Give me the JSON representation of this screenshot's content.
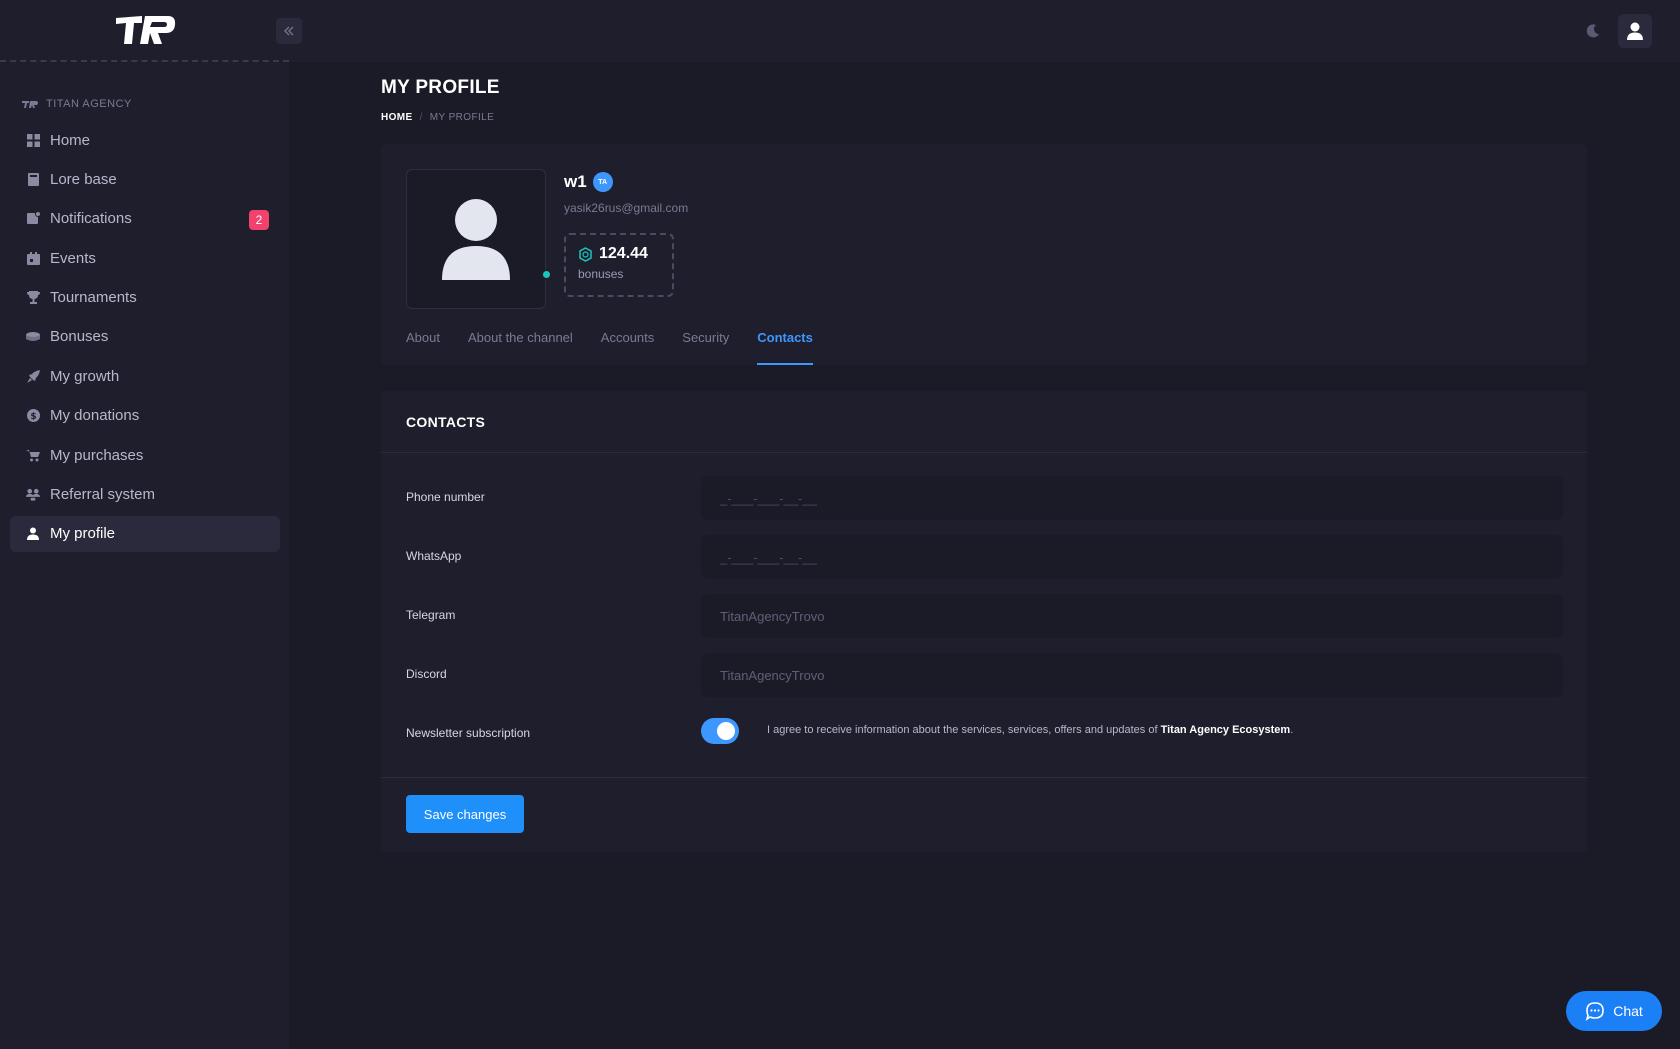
{
  "app": {
    "brand": "TA",
    "section_label": "TITAN AGENCY"
  },
  "sidebar": {
    "items": [
      {
        "label": "Home",
        "icon": "grid-icon"
      },
      {
        "label": "Lore base",
        "icon": "book-icon"
      },
      {
        "label": "Notifications",
        "icon": "bell-icon",
        "badge": "2"
      },
      {
        "label": "Events",
        "icon": "calendar-icon"
      },
      {
        "label": "Tournaments",
        "icon": "trophy-icon"
      },
      {
        "label": "Bonuses",
        "icon": "coins-icon"
      },
      {
        "label": "My growth",
        "icon": "rocket-icon"
      },
      {
        "label": "My donations",
        "icon": "dollar-icon"
      },
      {
        "label": "My purchases",
        "icon": "cart-icon"
      },
      {
        "label": "Referral system",
        "icon": "people-icon"
      },
      {
        "label": "My profile",
        "icon": "user-icon",
        "active": true
      }
    ]
  },
  "header": {
    "title": "MY PROFILE",
    "breadcrumb": {
      "home": "HOME",
      "sep": "/",
      "current": "MY PROFILE"
    }
  },
  "profile": {
    "username": "w1",
    "verified_badge": "TA",
    "email": "yasik26rus@gmail.com",
    "bonus_value": "124.44",
    "bonus_label": "bonuses",
    "online": true
  },
  "tabs": [
    {
      "label": "About"
    },
    {
      "label": "About the channel"
    },
    {
      "label": "Accounts"
    },
    {
      "label": "Security"
    },
    {
      "label": "Contacts",
      "active": true
    }
  ],
  "contacts": {
    "title": "CONTACTS",
    "phone": {
      "label": "Phone number",
      "placeholder": "_-___-___-__-__"
    },
    "whatsapp": {
      "label": "WhatsApp",
      "placeholder": "_-___-___-__-__"
    },
    "telegram": {
      "label": "Telegram",
      "value": "TitanAgencyTrovo"
    },
    "discord": {
      "label": "Discord",
      "value": "TitanAgencyTrovo"
    },
    "newsletter": {
      "label": "Newsletter subscription",
      "enabled": true,
      "text": "I agree to receive information about the services, services, offers and updates of ",
      "text_bold": "Titan Agency Ecosystem",
      "text_end": "."
    },
    "save_label": "Save changes"
  },
  "chat": {
    "label": "Chat"
  },
  "colors": {
    "accent": "#3e97ff",
    "badge": "#f1416c",
    "online": "#1bc5bd",
    "background": "#1b1b28",
    "panel": "#1e1e2d"
  }
}
